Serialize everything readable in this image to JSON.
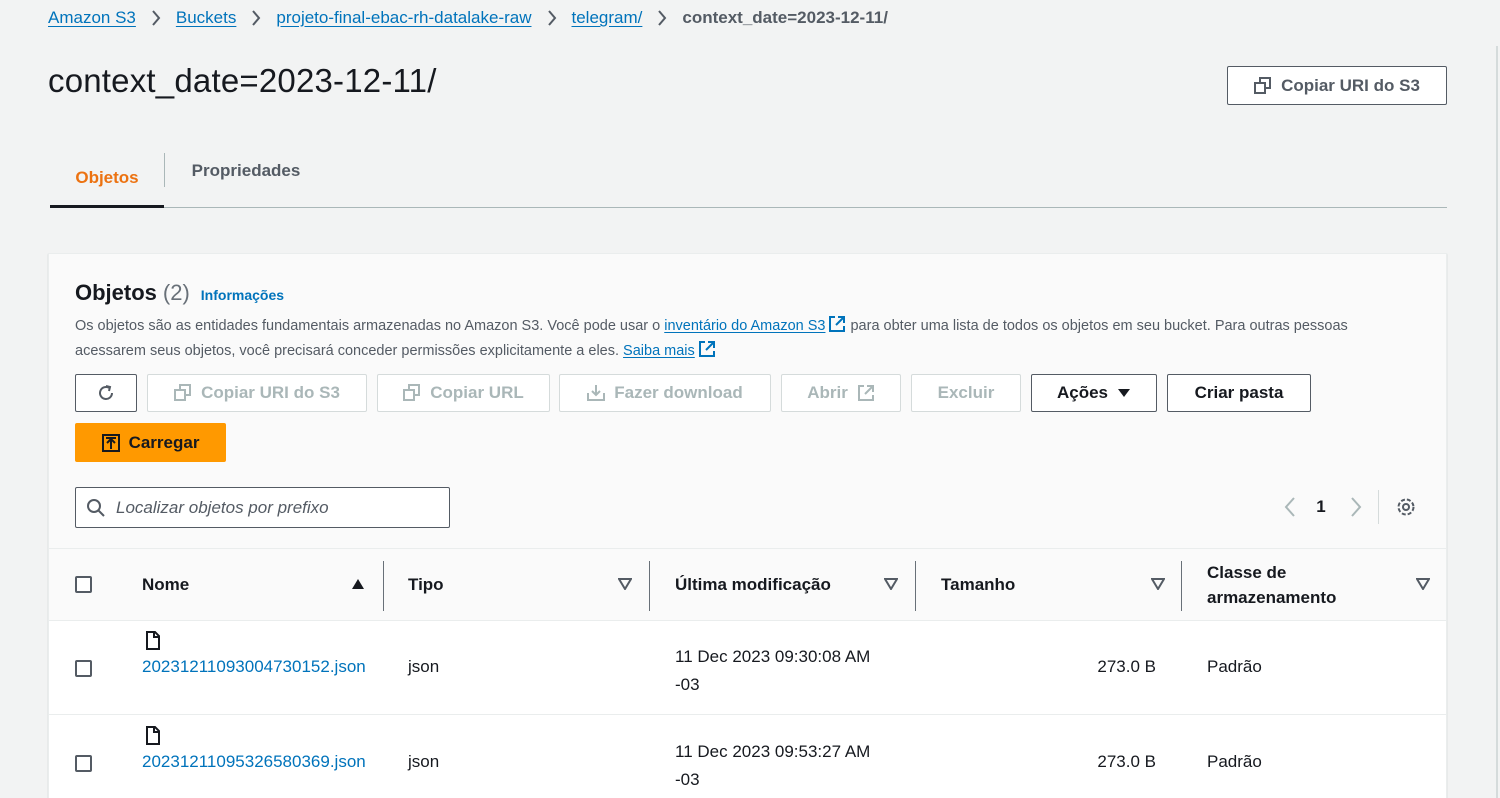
{
  "breadcrumb": [
    "Amazon S3",
    "Buckets",
    "projeto-final-ebac-rh-datalake-raw",
    "telegram/"
  ],
  "breadcrumb_current": "context_date=2023-12-11/",
  "page": {
    "title": "context_date=2023-12-11/",
    "copy_uri_button": "Copiar URI do S3"
  },
  "tabs": [
    "Objetos",
    "Propriedades"
  ],
  "panel": {
    "title": "Objetos",
    "count": "(2)",
    "info_link": "Informações",
    "desc_part1": "Os objetos são as entidades fundamentais armazenadas no Amazon S3. Você pode usar o ",
    "desc_link1": "inventário do Amazon S3",
    "desc_part2": " para obter uma lista de todos os objetos em seu bucket. Para outras pessoas acessarem seus objetos, você precisará conceder permissões explicitamente a eles. ",
    "desc_link2": "Saiba mais"
  },
  "toolbar": {
    "copy_uri": "Copiar URI do S3",
    "copy_url": "Copiar URL",
    "download": "Fazer download",
    "open": "Abrir",
    "delete": "Excluir",
    "actions": "Ações",
    "create_folder": "Criar pasta",
    "upload": "Carregar"
  },
  "search": {
    "placeholder": "Localizar objetos por prefixo"
  },
  "pagination": {
    "page": "1"
  },
  "table": {
    "columns": [
      "Nome",
      "Tipo",
      "Última modificação",
      "Tamanho",
      "Classe de armazenamento"
    ],
    "rows": [
      {
        "name": "20231211093004730152.json",
        "type": "json",
        "modified": "11 Dec 2023 09:30:08 AM -03",
        "size": "273.0 B",
        "storage": "Padrão"
      },
      {
        "name": "20231211095326580369.json",
        "type": "json",
        "modified": "11 Dec 2023 09:53:27 AM -03",
        "size": "273.0 B",
        "storage": "Padrão"
      }
    ]
  },
  "colors": {
    "link": "#0073bb",
    "accent": "#ec7211",
    "primary_button": "#ff9900"
  }
}
